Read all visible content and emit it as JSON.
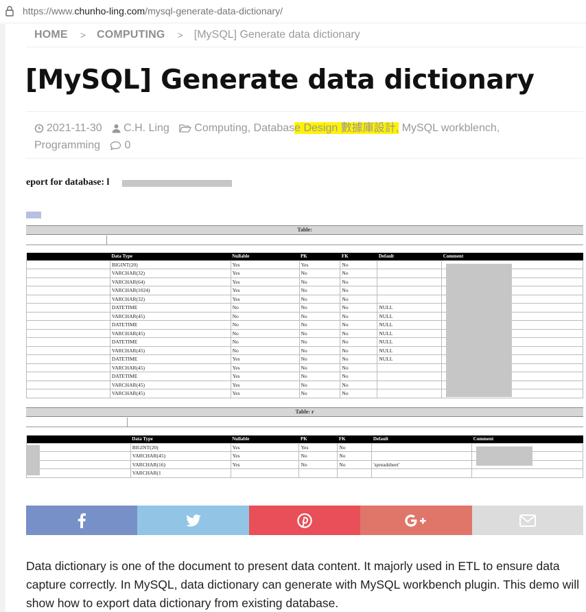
{
  "browser": {
    "url_prefix": "https://www.",
    "url_domain": "chunho-ling.com",
    "url_path": "/mysql-generate-data-dictionary/"
  },
  "breadcrumb": {
    "home": "HOME",
    "category": "COMPUTING",
    "current": "[MySQL] Generate data dictionary",
    "separator": ">"
  },
  "post": {
    "title": "[MySQL] Generate data dictionary",
    "date": "2021-11-30",
    "author": "C.H. Ling",
    "categories_pre": "Computing, Databas",
    "categories_highlight": "e Design 數據庫設計,",
    "categories_post": "MySQL workblench,",
    "categories_line2": "Programming",
    "comments": "0",
    "body": "Data dictionary is one of the document to present data content. It majorly used in ETL to ensure data capture correctly. In MySQL, data dictionary can generate with MySQL workbench plugin. This demo will show how to export data dictionary from existing database."
  },
  "screenshot": {
    "report_title": "eport for database: l",
    "table1_label": "Table:",
    "table2_label": "Table: r",
    "columns": [
      "Data Type",
      "Nullable",
      "PK",
      "FK",
      "Default",
      "Comment"
    ],
    "table1_rows": [
      [
        "BIGINT(20)",
        "Yes",
        "Yes",
        "No",
        "",
        ""
      ],
      [
        "VARCHAR(32)",
        "Yes",
        "No",
        "No",
        "",
        ""
      ],
      [
        "VARCHAR(64)",
        "Yes",
        "No",
        "No",
        "",
        ""
      ],
      [
        "VARCHAR(1024)",
        "Yes",
        "No",
        "No",
        "",
        ""
      ],
      [
        "VARCHAR(32)",
        "Yes",
        "No",
        "No",
        "",
        ""
      ],
      [
        "DATETIME",
        "No",
        "No",
        "No",
        "NULL",
        ""
      ],
      [
        "VARCHAR(45)",
        "No",
        "No",
        "No",
        "NULL",
        ""
      ],
      [
        "DATETIME",
        "No",
        "No",
        "No",
        "NULL",
        ""
      ],
      [
        "VARCHAR(45)",
        "No",
        "No",
        "No",
        "NULL",
        ""
      ],
      [
        "DATETIME",
        "No",
        "No",
        "No",
        "NULL",
        ""
      ],
      [
        "VARCHAR(45)",
        "No",
        "No",
        "No",
        "NULL",
        ""
      ],
      [
        "DATETIME",
        "Yes",
        "No",
        "No",
        "NULL",
        ""
      ],
      [
        "VARCHAR(45)",
        "Yes",
        "No",
        "No",
        "",
        ""
      ],
      [
        "DATETIME",
        "Yes",
        "No",
        "No",
        "",
        ""
      ],
      [
        "VARCHAR(45)",
        "Yes",
        "No",
        "No",
        "",
        ""
      ],
      [
        "VARCHAR(45)",
        "Yes",
        "No",
        "No",
        "",
        ""
      ]
    ],
    "table2_rows": [
      [
        "BIGINT(20)",
        "Yes",
        "Yes",
        "No",
        "",
        ""
      ],
      [
        "VARCHAR(45)",
        "Yes",
        "No",
        "No",
        "",
        ""
      ],
      [
        "VARCHAR(16)",
        "Yes",
        "No",
        "No",
        "'spreadsheet'",
        ""
      ],
      [
        "VARCHAR(1",
        "",
        "",
        "",
        "",
        ""
      ]
    ]
  },
  "share": {
    "facebook_icon": "facebook-icon",
    "twitter_icon": "twitter-icon",
    "pinterest_icon": "pinterest-icon",
    "googleplus_icon": "google-plus-icon",
    "email_icon": "email-icon",
    "colors": {
      "facebook": "#7890c8",
      "twitter": "#92c4e6",
      "pinterest": "#e84f58",
      "googleplus": "#e0756a",
      "email": "#dcdcdc"
    }
  }
}
